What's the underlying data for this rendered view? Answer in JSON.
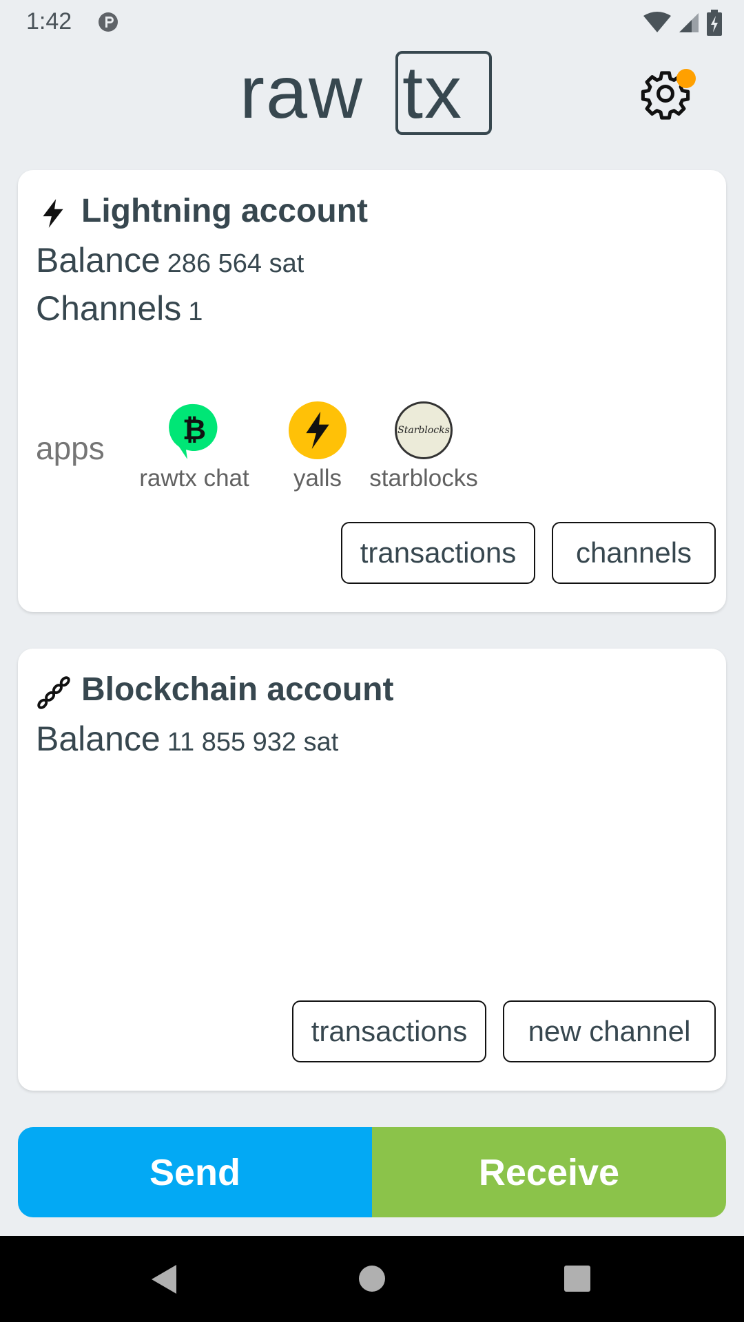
{
  "status": {
    "time": "1:42"
  },
  "header": {
    "logo_left": "raw",
    "logo_right": "tx"
  },
  "lightning": {
    "title": "Lightning account",
    "balance_label": "Balance",
    "balance_value": "286 564 sat",
    "channels_label": "Channels",
    "channels_value": "1",
    "apps_label": "apps",
    "apps": [
      {
        "name": "rawtx chat",
        "icon": "bitcoin-chat-icon"
      },
      {
        "name": "yalls",
        "icon": "bolt-icon"
      },
      {
        "name": "starblocks",
        "icon": "starblocks-icon"
      }
    ],
    "buttons": {
      "transactions": "transactions",
      "channels": "channels"
    }
  },
  "blockchain": {
    "title": "Blockchain account",
    "balance_label": "Balance",
    "balance_value": "11 855 932 sat",
    "buttons": {
      "transactions": "transactions",
      "new_channel": "new channel"
    }
  },
  "actions": {
    "send": "Send",
    "receive": "Receive"
  },
  "colors": {
    "send": "#03a9f4",
    "receive": "#8bc34a",
    "settings_dot": "#ffa000",
    "text": "#37474f"
  }
}
